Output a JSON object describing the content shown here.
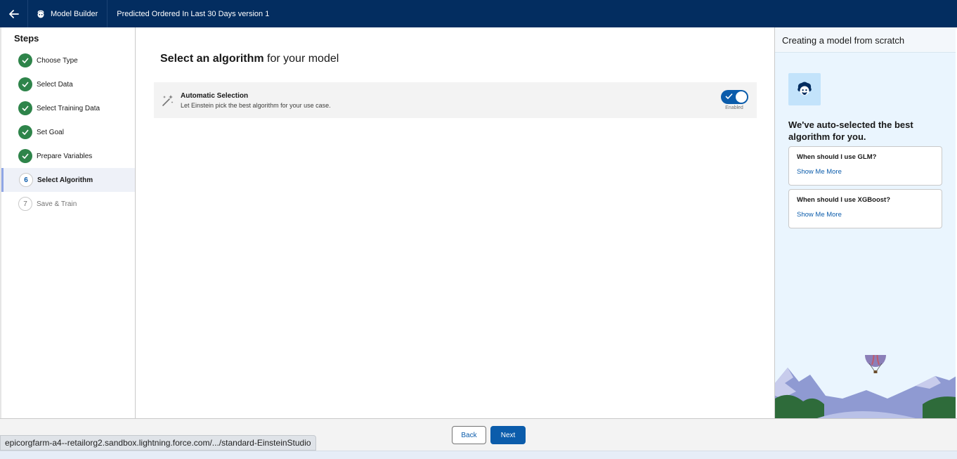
{
  "header": {
    "app_name": "Model Builder",
    "model_title": "Predicted Ordered In Last 30 Days version 1"
  },
  "sidebar": {
    "title": "Steps",
    "steps": [
      {
        "label": "Choose Type",
        "state": "done"
      },
      {
        "label": "Select Data",
        "state": "done"
      },
      {
        "label": "Select Training Data",
        "state": "done"
      },
      {
        "label": "Set Goal",
        "state": "done"
      },
      {
        "label": "Prepare Variables",
        "state": "done"
      },
      {
        "label": "Select Algorithm",
        "state": "current",
        "number": "6"
      },
      {
        "label": "Save & Train",
        "state": "future",
        "number": "7"
      }
    ]
  },
  "main": {
    "title_bold": "Select an algorithm",
    "title_rest": " for your model",
    "option": {
      "title": "Automatic Selection",
      "description": "Let Einstein pick the best algorithm for your use case.",
      "toggle_label": "Enabled",
      "toggle_on": true
    }
  },
  "right_panel": {
    "header": "Creating a model from scratch",
    "heading": "We've auto-selected the best algorithm for you.",
    "cards": [
      {
        "question": "When should I use GLM?",
        "link": "Show Me More"
      },
      {
        "question": "When should I use XGBoost?",
        "link": "Show Me More"
      }
    ]
  },
  "footer": {
    "back_label": "Back",
    "next_label": "Next"
  },
  "status_bar": {
    "url": "epicorgfarm-a4--retailorg2.sandbox.lightning.force.com/.../standard-EinsteinStudio"
  },
  "colors": {
    "header_bg": "#032d60",
    "brand_blue": "#0b5cab",
    "success_green": "#2e844a",
    "panel_bg": "#eaf5fe"
  }
}
